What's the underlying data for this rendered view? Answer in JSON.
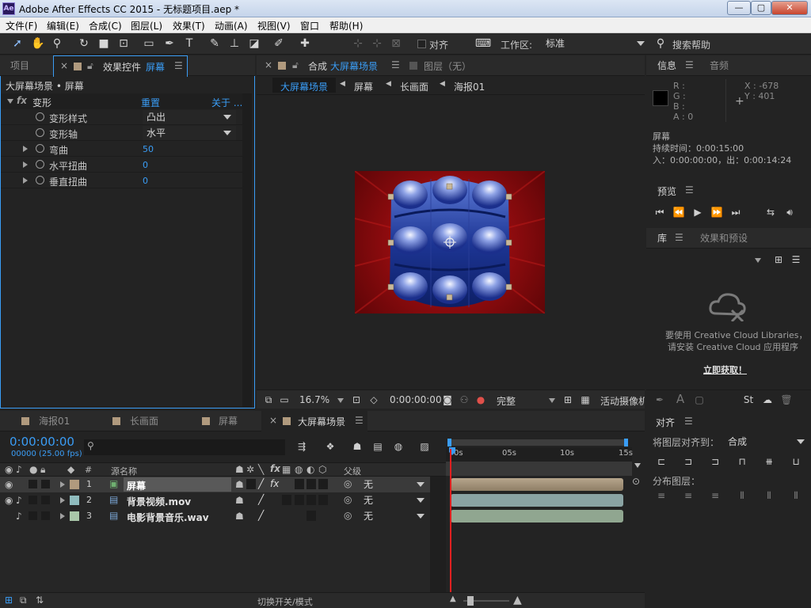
{
  "window": {
    "title": "Adobe After Effects CC 2015 - 无标题项目.aep *",
    "app_icon": "Ae",
    "controls": {
      "minimize": "—",
      "maximize": "▢",
      "close": "✕"
    }
  },
  "menu": [
    "文件(F)",
    "编辑(E)",
    "合成(C)",
    "图层(L)",
    "效果(T)",
    "动画(A)",
    "视图(V)",
    "窗口",
    "帮助(H)"
  ],
  "toolbar": {
    "align_label": "对齐",
    "workspace_label": "工作区:",
    "workspace_value": "标准",
    "search_placeholder": "搜索帮助"
  },
  "project_panel": {
    "tab_project": "项目",
    "tab_effects": "效果控件",
    "tab_effects_target": "屏幕",
    "breadcrumb": "大屏幕场景 • 屏幕"
  },
  "effect": {
    "fx_label": "fx",
    "name": "变形",
    "reset": "重置",
    "about": "关于 ...",
    "props": [
      {
        "label": "变形样式",
        "value": "凸出",
        "type": "dropdown"
      },
      {
        "label": "变形轴",
        "value": "水平",
        "type": "dropdown"
      },
      {
        "label": "弯曲",
        "value": "50",
        "type": "number"
      },
      {
        "label": "水平扭曲",
        "value": "0",
        "type": "number"
      },
      {
        "label": "垂直扭曲",
        "value": "0",
        "type": "number"
      }
    ]
  },
  "comp_panel": {
    "tab_comp_prefix": "合成",
    "tab_comp_name": "大屏幕场景",
    "tab_layer": "图层（无）",
    "breadcrumbs": [
      "大屏幕场景",
      "屏幕",
      "长画面",
      "海报01"
    ],
    "bottom": {
      "zoom": "16.7%",
      "timecode": "0:00:00:00",
      "quality": "完整",
      "camera": "活动摄像机"
    }
  },
  "info_panel": {
    "tab_info": "信息",
    "tab_audio": "音频",
    "r": "R :",
    "g": "G :",
    "b": "B :",
    "a": "A : 0",
    "x": "X : -678",
    "y": "Y : 401",
    "layer_name": "屏幕",
    "duration": "持续时间：0:00:15:00",
    "in_out": "入：0:00:00:00，出：0:00:14:24"
  },
  "preview_panel": {
    "title": "预览"
  },
  "library_panel": {
    "tab_library": "库",
    "tab_effects": "效果和预设",
    "msg_line1": "要使用 Creative Cloud Libraries，",
    "msg_line2": "请安装 Creative Cloud 应用程序",
    "link": "立即获取！"
  },
  "timeline": {
    "tabs": [
      "海报01",
      "长画面",
      "屏幕",
      "大屏幕场景"
    ],
    "timecode": "0:00:00:00",
    "frames": "00000 (25.00 fps)",
    "col_num": "#",
    "col_source": "源名称",
    "col_parent": "父级",
    "ruler": [
      "0s",
      "05s",
      "10s",
      "15s"
    ],
    "layers": [
      {
        "num": "1",
        "name": "屏幕",
        "parent": "无",
        "color": "#b09a7e"
      },
      {
        "num": "2",
        "name": "背景视频.mov",
        "parent": "无",
        "color": "#8fbcbe"
      },
      {
        "num": "3",
        "name": "电影背景音乐.wav",
        "parent": "无",
        "color": "#a9c7a9"
      }
    ],
    "toggle_label": "切换开关/模式"
  },
  "align_panel": {
    "title": "对齐",
    "align_to_label": "将图层对齐到：",
    "align_to_value": "合成",
    "distribute_label": "分布图层："
  },
  "colors": {
    "accent": "#3a9df6",
    "panel_bg": "#232323",
    "tab_bg": "#2a2a2a",
    "comp_red": "#8b0c0f",
    "layer_blue": "#1e3f9e",
    "playhead": "#e02020"
  }
}
